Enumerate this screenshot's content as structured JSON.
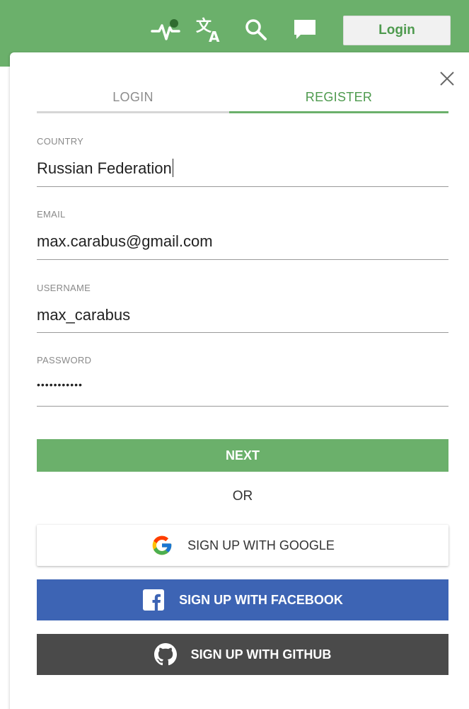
{
  "header": {
    "icons": [
      "activity-icon",
      "translate-icon",
      "search-icon",
      "chat-icon"
    ],
    "login_button": "Login"
  },
  "tabs": [
    {
      "label": "LOGIN",
      "active": false
    },
    {
      "label": "REGISTER",
      "active": true
    }
  ],
  "form": {
    "country": {
      "label": "COUNTRY",
      "value": "Russian Federation"
    },
    "email": {
      "label": "EMAIL",
      "value": "max.carabus@gmail.com"
    },
    "username": {
      "label": "USERNAME",
      "value": "max_carabus"
    },
    "password": {
      "label": "PASSWORD",
      "value": "•••••••••••"
    }
  },
  "buttons": {
    "next": "NEXT",
    "or": "OR",
    "google": "SIGN UP WITH GOOGLE",
    "facebook": "SIGN UP WITH FACEBOOK",
    "github": "SIGN UP WITH GITHUB"
  },
  "colors": {
    "accent": "#6bb06b",
    "facebook": "#3d64b4",
    "github": "#4a4a4a"
  }
}
